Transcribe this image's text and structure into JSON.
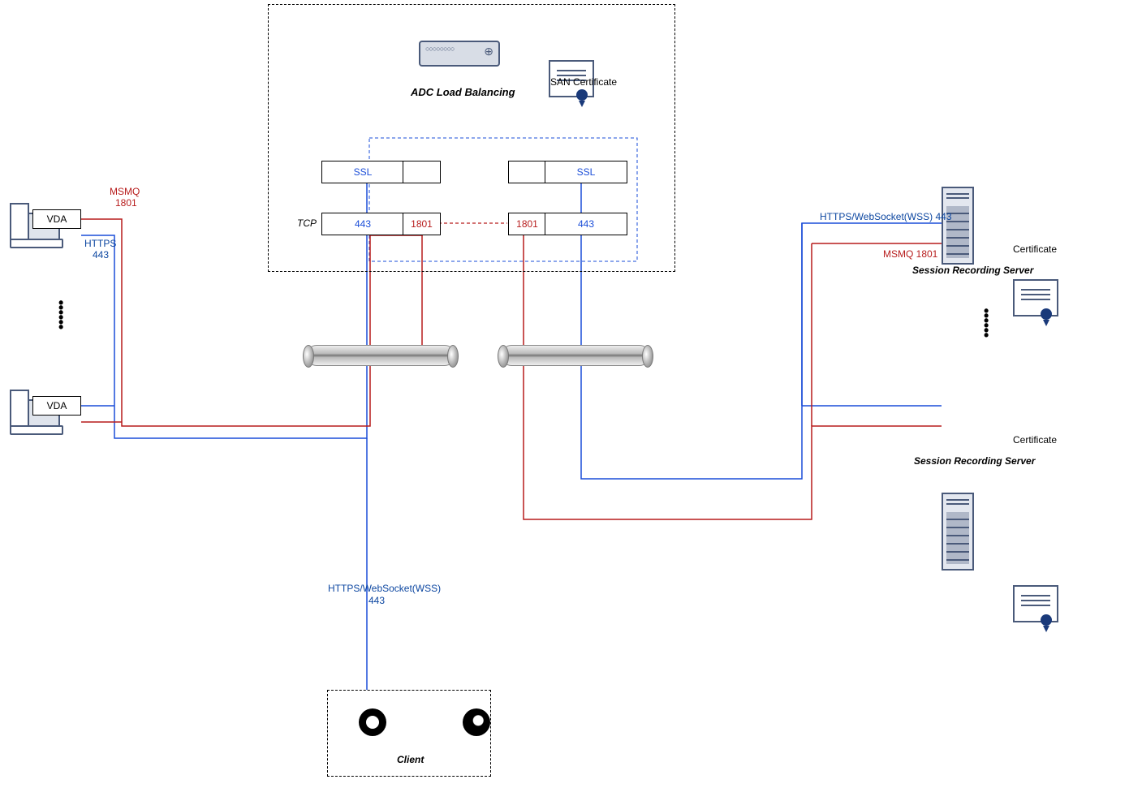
{
  "adc": {
    "title": "ADC Load Balancing",
    "san_cert": "SAN Certificate",
    "left": {
      "ssl": "SSL",
      "tcp": "TCP",
      "port443": "443",
      "port1801": "1801"
    },
    "right": {
      "ssl": "SSL",
      "port443": "443",
      "port1801": "1801"
    }
  },
  "vda": {
    "label": "VDA",
    "msmq": "MSMQ",
    "msmq_port": "1801",
    "https": "HTTPS",
    "https_port": "443"
  },
  "client": {
    "title": "Client",
    "protocol": "HTTPS/WebSocket(WSS)",
    "port": "443"
  },
  "server": {
    "title": "Session Recording Server",
    "cert": "Certificate",
    "https_ws": "HTTPS/WebSocket(WSS)  443",
    "msmq": "MSMQ  1801"
  }
}
